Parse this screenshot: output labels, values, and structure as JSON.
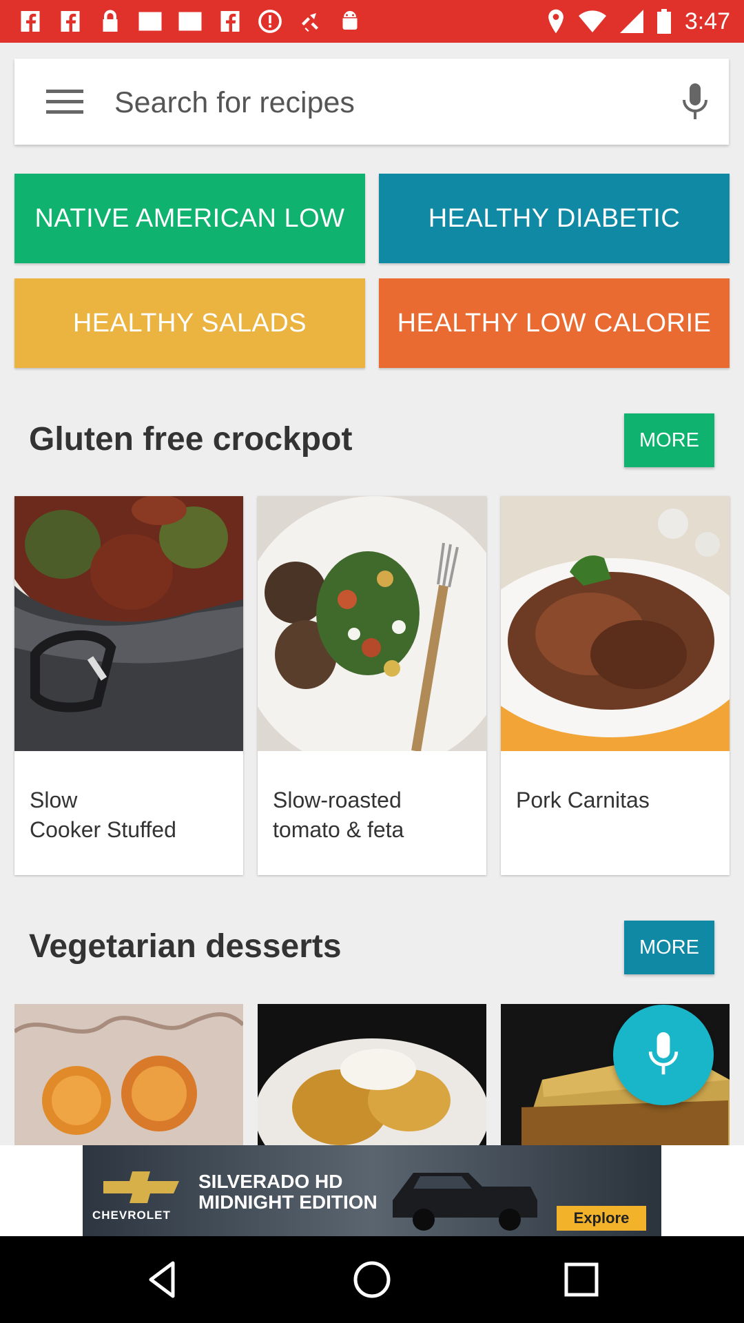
{
  "status_bar": {
    "time": "3:47",
    "left_icons": [
      "facebook-icon",
      "facebook-icon",
      "lock-icon",
      "blank-notification-icon",
      "blank-notification-icon",
      "facebook-icon",
      "alert-icon",
      "fake-gps-icon",
      "android-icon"
    ],
    "right_icons": [
      "location-icon",
      "wifi-icon",
      "signal-icon",
      "battery-icon"
    ]
  },
  "search": {
    "placeholder": "Search for recipes",
    "value": ""
  },
  "categories": [
    {
      "label": "NATIVE AMERICAN LOW",
      "color": "#0fb26e"
    },
    {
      "label": "HEALTHY DIABETIC",
      "color": "#0f89a4"
    },
    {
      "label": "HEALTHY SALADS",
      "color": "#ebb340"
    },
    {
      "label": "HEALTHY LOW CALORIE",
      "color": "#ea6b31"
    }
  ],
  "sections": [
    {
      "title": "Gluten free crockpot",
      "more_label": "MORE",
      "more_color": "#0fb26e",
      "recipes": [
        {
          "title": "Slow\nCooker Stuffed"
        },
        {
          "title": "Slow-roasted\ntomato & feta"
        },
        {
          "title": "Pork Carnitas"
        }
      ]
    },
    {
      "title": "Vegetarian desserts",
      "more_label": "MORE",
      "more_color": "#0f89a4"
    }
  ],
  "ad": {
    "brand": "CHEVROLET",
    "headline": "SILVERADO HD\nMIDNIGHT EDITION",
    "cta": "Explore"
  },
  "colors": {
    "status_bar": "#e0322b",
    "fab": "#19b6c9"
  }
}
